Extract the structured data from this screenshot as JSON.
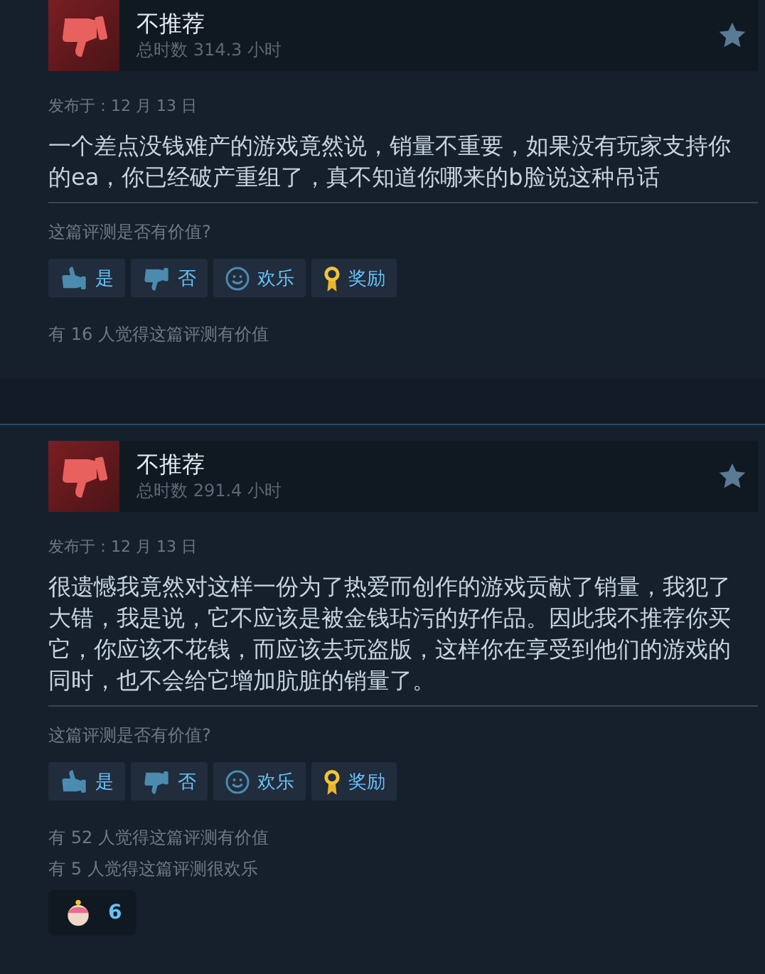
{
  "reviews": [
    {
      "verdict": "不推荐",
      "recommended": false,
      "hours": "总时数 314.3 小时",
      "posted": "发布于：12 月 13 日",
      "text": "一个差点没钱难产的游戏竟然说，销量不重要，如果没有玩家支持你的ea，你已经破产重组了，真不知道你哪来的b脸说这种吊话",
      "question": "这篇评测是否有价值?",
      "buttons": [
        {
          "kind": "yes",
          "label": "是"
        },
        {
          "kind": "no",
          "label": "否"
        },
        {
          "kind": "funny",
          "label": "欢乐"
        },
        {
          "kind": "award",
          "label": "奖励"
        }
      ],
      "helpful": [
        "有 16 人觉得这篇评测有价值"
      ]
    },
    {
      "verdict": "不推荐",
      "recommended": false,
      "hours": "总时数 291.4 小时",
      "posted": "发布于：12 月 13 日",
      "text": "很遗憾我竟然对这样一份为了热爱而创作的游戏贡献了销量，我犯了大错，我是说，它不应该是被金钱玷污的好作品。因此我不推荐你买它，你应该不花钱，而应该去玩盗版，这样你在享受到他们的游戏的同时，也不会给它增加肮脏的销量了。",
      "question": "这篇评测是否有价值?",
      "buttons": [
        {
          "kind": "yes",
          "label": "是"
        },
        {
          "kind": "no",
          "label": "否"
        },
        {
          "kind": "funny",
          "label": "欢乐"
        },
        {
          "kind": "award",
          "label": "奖励"
        }
      ],
      "helpful": [
        "有 52 人觉得这篇评测有价值",
        "有 5 人觉得这篇评测很欢乐"
      ],
      "awards": [
        {
          "count": "6"
        }
      ]
    }
  ]
}
